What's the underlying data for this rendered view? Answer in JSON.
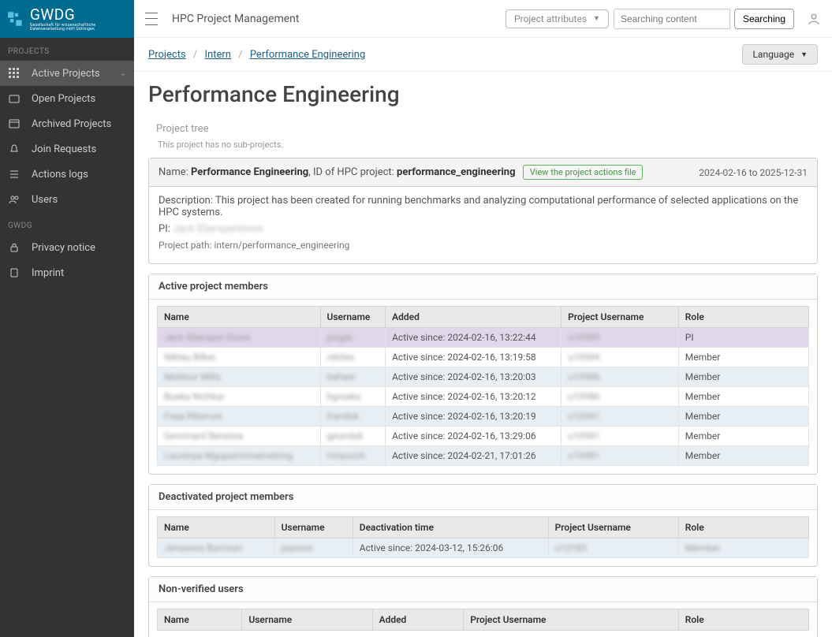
{
  "logo": {
    "main": "GWDG",
    "sub": "Gesellschaft für wissenschaftliche Datenverarbeitung mbH Göttingen"
  },
  "topbar": {
    "title": "HPC Project Management",
    "attr_button": "Project attributes",
    "search_placeholder": "Searching content",
    "search_button": "Searching"
  },
  "sidebar": {
    "groups": [
      {
        "label": "PROJECTS",
        "items": [
          {
            "label": "Active Projects",
            "icon": "grid-icon",
            "active": true,
            "chev": true
          },
          {
            "label": "Open Projects",
            "icon": "folder-icon"
          },
          {
            "label": "Archived Projects",
            "icon": "archive-icon"
          },
          {
            "label": "Join Requests",
            "icon": "bell-icon"
          },
          {
            "label": "Actions logs",
            "icon": "list-icon"
          },
          {
            "label": "Users",
            "icon": "users-icon"
          }
        ]
      },
      {
        "label": "GWDG",
        "items": [
          {
            "label": "Privacy notice",
            "icon": "lock-icon"
          },
          {
            "label": "Imprint",
            "icon": "doc-icon"
          }
        ]
      }
    ]
  },
  "breadcrumb": {
    "items": [
      "Projects",
      "Intern",
      "Performance Engineering"
    ]
  },
  "language_button": "Language",
  "page_title": "Performance Engineering",
  "tree": {
    "label": "Project tree",
    "empty": "This project has no sub-projects."
  },
  "project_header": {
    "name_label": "Name: ",
    "name": "Performance Engineering",
    "id_label": ", ID of HPC project: ",
    "id": "performance_engineering",
    "action_link": "View the project actions file",
    "dates": "2024-02-16 to 2025-12-31"
  },
  "project_body": {
    "desc_label": "Description: ",
    "desc": "This project has been created for running benchmarks and analyzing computational performance of selected applications on the HPC systems.",
    "pi_label": "PI: ",
    "pi": "Jack Ebersperdores",
    "path_label": "Project path: ",
    "path": "intern/performance_engineering"
  },
  "active_members": {
    "title": "Active project members",
    "cols": [
      "Name",
      "Username",
      "Added",
      "Project Username",
      "Role"
    ],
    "rows": [
      {
        "name": "Jack Ebersper Dores",
        "user": "jeogle",
        "added": "Active since: 2024-02-16, 13:22:44",
        "puser": "u10989",
        "role": "PI"
      },
      {
        "name": "Niklau Bilkei",
        "user": "nibilas",
        "added": "Active since: 2024-02-16, 13:19:58",
        "puser": "u10984",
        "role": "Member"
      },
      {
        "name": "Maldsur Mills",
        "user": "bahaer",
        "added": "Active since: 2024-02-16, 13:20:03",
        "puser": "u10986",
        "role": "Member"
      },
      {
        "name": "Bueka Nichkar",
        "user": "bgroaks",
        "added": "Active since: 2024-02-16, 13:20:12",
        "puser": "u10986",
        "role": "Member"
      },
      {
        "name": "Freja Riberure",
        "user": "frandok",
        "added": "Active since: 2024-02-16, 13:20:19",
        "puser": "u10981",
        "role": "Member"
      },
      {
        "name": "Gerrimard Benstoa",
        "user": "geundok",
        "added": "Active since: 2024-02-16, 13:29:06",
        "puser": "u10981",
        "role": "Member"
      },
      {
        "name": "Laurenya Mgupuirimnametong",
        "user": "mnyunch",
        "added": "Active since: 2024-02-21, 17:01:26",
        "puser": "u10981",
        "role": "Member"
      }
    ]
  },
  "deactivated_members": {
    "title": "Deactivated project members",
    "cols": [
      "Name",
      "Username",
      "Deactivation time",
      "Project Username",
      "Role"
    ],
    "rows": [
      {
        "name": "Jensenes Burrouin",
        "user": "jsanoot",
        "added": "Active since: 2024-03-12, 15:26:06",
        "puser": "u10183",
        "role": "Member"
      }
    ]
  },
  "nonverified": {
    "title": "Non-verified users",
    "cols": [
      "Name",
      "Username",
      "Added",
      "Project Username",
      "Role"
    ]
  }
}
